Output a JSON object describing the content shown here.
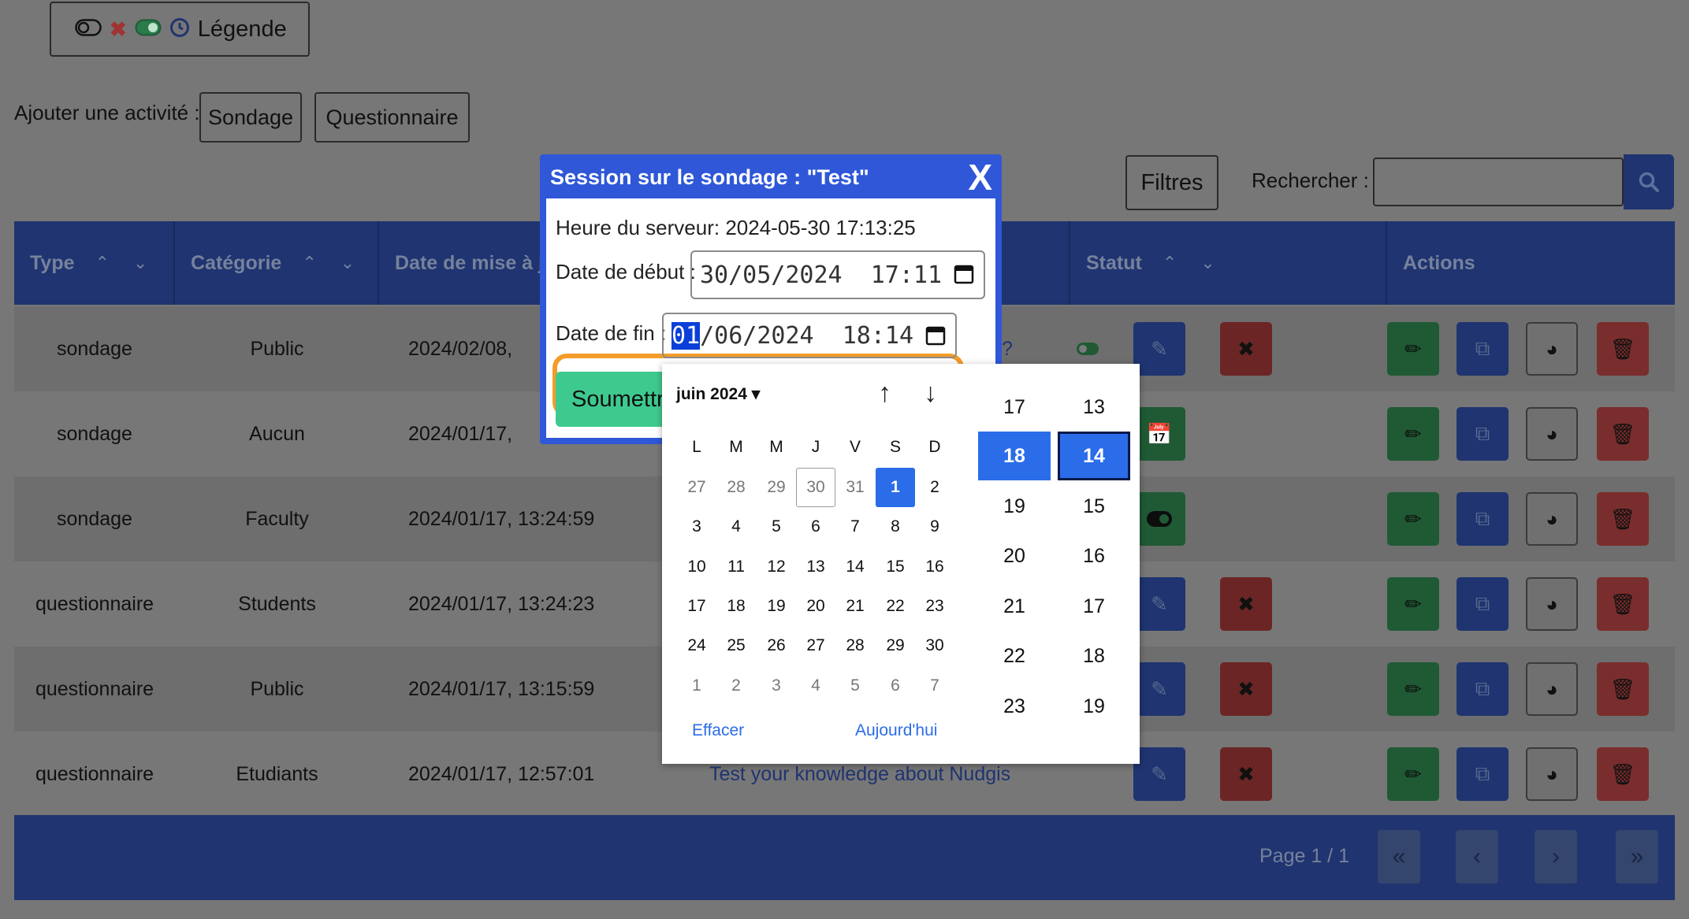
{
  "legend": {
    "label": "Légende",
    "icons": [
      "toggle-off-icon",
      "close-icon",
      "toggle-on-icon",
      "clock-icon"
    ]
  },
  "add_activity": {
    "label": "Ajouter une activité :",
    "buttons": [
      "Sondage",
      "Questionnaire"
    ]
  },
  "toolbar": {
    "filters_label": "Filtres",
    "search_label": "Rechercher :",
    "search_value": ""
  },
  "table": {
    "headers": [
      "Type",
      "Catégorie",
      "Date de mise à jo",
      "Statut",
      "Actions"
    ],
    "rows": [
      {
        "type": "sondage",
        "category": "Public",
        "date": "2024/02/08,"
      },
      {
        "type": "sondage",
        "category": "Aucun",
        "date": "2024/01/17,"
      },
      {
        "type": "sondage",
        "category": "Faculty",
        "date": "2024/01/17, 13:24:59"
      },
      {
        "type": "questionnaire",
        "category": "Students",
        "date": "2024/01/17, 13:24:23"
      },
      {
        "type": "questionnaire",
        "category": "Public",
        "date": "2024/01/17, 13:15:59"
      },
      {
        "type": "questionnaire",
        "category": "Etudiants",
        "date": "2024/01/17, 12:57:01",
        "title": "Test your knowledge about Nudgis"
      }
    ],
    "row1_fragment": "?",
    "pager": {
      "label": "Page 1 / 1",
      "buttons": [
        "«",
        "‹",
        "›",
        "»"
      ]
    }
  },
  "modal": {
    "title": "Session sur le sondage : \"Test\"",
    "close": "X",
    "server_time": "Heure du serveur: 2024-05-30 17:13:25",
    "start_label": "Date de début :",
    "start_value": "30/05/2024  17:11",
    "end_label": "Date de fin :",
    "end_day": "01",
    "end_rest": "/06/2024  18:14",
    "submit_label": "Soumettr"
  },
  "picker": {
    "month": "juin 2024 ▾",
    "up": "↑",
    "down": "↓",
    "weekdays": [
      "L",
      "M",
      "M",
      "J",
      "V",
      "S",
      "D"
    ],
    "weeks": [
      [
        "27",
        "28",
        "29",
        "30",
        "31",
        "1",
        "2"
      ],
      [
        "3",
        "4",
        "5",
        "6",
        "7",
        "8",
        "9"
      ],
      [
        "10",
        "11",
        "12",
        "13",
        "14",
        "15",
        "16"
      ],
      [
        "17",
        "18",
        "19",
        "20",
        "21",
        "22",
        "23"
      ],
      [
        "24",
        "25",
        "26",
        "27",
        "28",
        "29",
        "30"
      ],
      [
        "1",
        "2",
        "3",
        "4",
        "5",
        "6",
        "7"
      ]
    ],
    "clear_label": "Effacer",
    "today_label": "Aujourd'hui",
    "hours": [
      "17",
      "18",
      "19",
      "20",
      "21",
      "22",
      "23"
    ],
    "minutes": [
      "13",
      "14",
      "15",
      "16",
      "17",
      "18",
      "19"
    ],
    "selected_hour": "18",
    "selected_minute": "14"
  },
  "colors": {
    "accent": "#2b6ce9",
    "modal_header": "#2f57d7",
    "highlight": "#f39c2a",
    "submit": "#3ec98f"
  }
}
